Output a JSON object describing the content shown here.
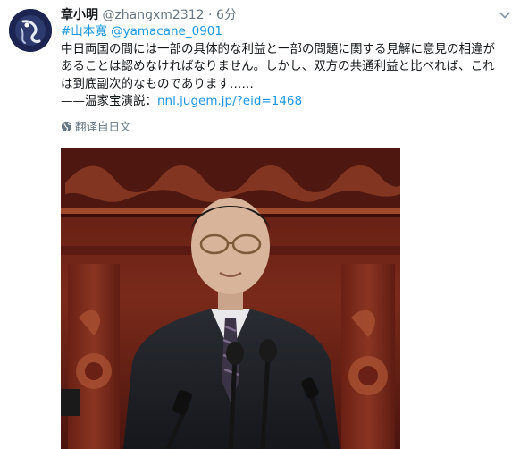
{
  "author": {
    "name": "章小明",
    "handle": "@zhangxm2312",
    "separator": "·",
    "time": "6分"
  },
  "tweet": {
    "mentions_line": {
      "hashtag": "#山本寛",
      "mention": "@yamacane_0901"
    },
    "text_lines": [
      "中日両国の間には一部の具体的な利益と一部の問題に関する見解に意見の相違が",
      "あることは認めなければなりません。しかし、双方の共通利益と比べれば、これ",
      "は到底副次的なものであります……"
    ],
    "source_prefix": "——温家宝演説：",
    "source_link": "nnl.jugem.jp/?eid=1468"
  },
  "translate_label": "翻译自日文",
  "icons": {
    "caret": "chevron-down-icon",
    "translate": "globe-icon"
  },
  "colors": {
    "link": "#1b95e0",
    "secondary": "#657786",
    "wood": "#7a2418"
  }
}
